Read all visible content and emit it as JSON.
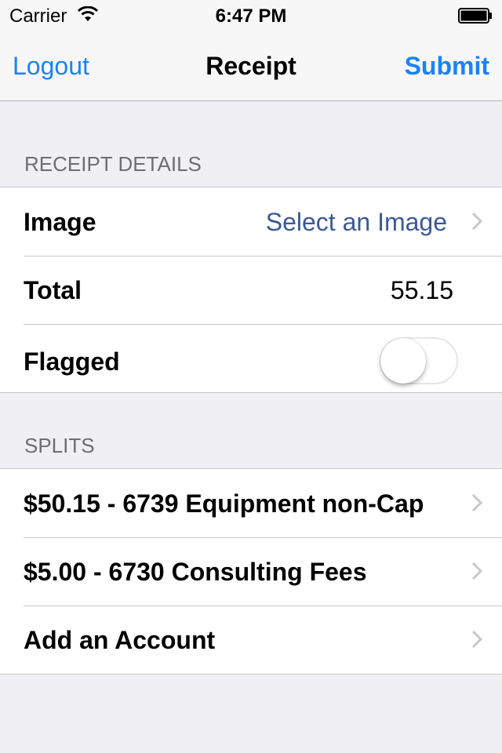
{
  "status_bar": {
    "carrier": "Carrier",
    "time": "6:47 PM"
  },
  "nav": {
    "left_label": "Logout",
    "title": "Receipt",
    "right_label": "Submit"
  },
  "receipt_details": {
    "header": "RECEIPT DETAILS",
    "image_label": "Image",
    "image_value": "Select an Image",
    "total_label": "Total",
    "total_value": "55.15",
    "flagged_label": "Flagged",
    "flagged_on": false
  },
  "splits": {
    "header": "SPLITS",
    "items": [
      {
        "label": "$50.15 - 6739 Equipment non-Cap"
      },
      {
        "label": "$5.00 - 6730 Consulting Fees"
      },
      {
        "label": "Add an Account"
      }
    ]
  },
  "colors": {
    "tint": "#1a82f7",
    "detail": "#3b5998",
    "background": "#efeff4"
  }
}
